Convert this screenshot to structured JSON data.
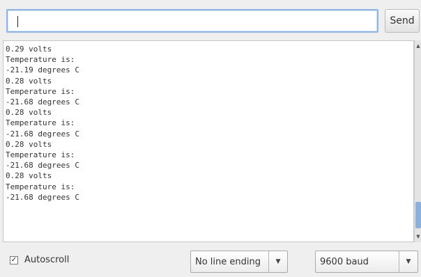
{
  "toolbar": {
    "input_value": "",
    "send_label": "Send"
  },
  "output": {
    "lines": [
      "0.29 volts",
      "Temperature is:",
      "-21.19 degrees C",
      "0.28 volts",
      "Temperature is:",
      "-21.68 degrees C",
      "0.28 volts",
      "Temperature is:",
      "-21.68 degrees C",
      "0.28 volts",
      "Temperature is:",
      "-21.68 degrees C",
      "0.28 volts",
      "Temperature is:",
      "-21.68 degrees C"
    ]
  },
  "footer": {
    "autoscroll_label": "Autoscroll",
    "autoscroll_checked": true,
    "line_ending": "No line ending",
    "baud_rate": "9600 baud"
  },
  "icons": {
    "checkbox": "check-icon",
    "dropdown": "chevron-down-icon",
    "scroll_up": "chevron-up-icon",
    "scroll_down": "chevron-down-icon"
  },
  "colors": {
    "input_focus": "#8fb7e2",
    "scroll_thumb": "#8ab1dd"
  }
}
